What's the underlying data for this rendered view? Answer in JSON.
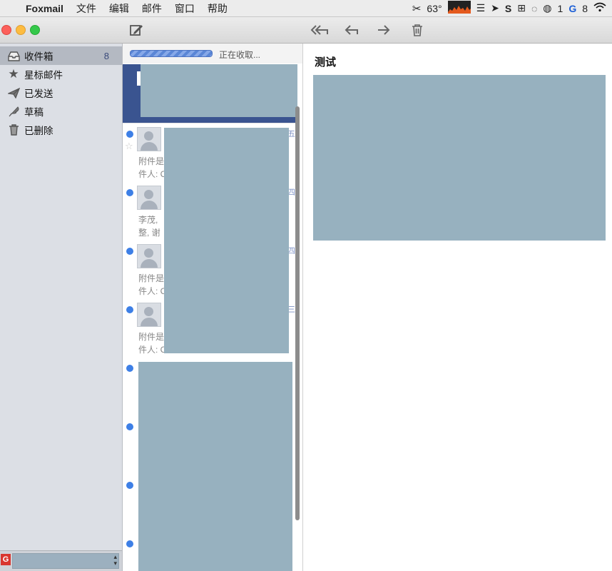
{
  "menubar": {
    "app_name": "Foxmail",
    "menus": [
      "文件",
      "编辑",
      "邮件",
      "窗口",
      "帮助"
    ],
    "status": {
      "temperature": "63°",
      "wechat_count": "1",
      "app_badge_count": "8"
    }
  },
  "sidebar": {
    "folders": [
      {
        "label": "收件箱",
        "count": "8",
        "icon": "inbox-icon"
      },
      {
        "label": "星标邮件",
        "icon": "star-icon"
      },
      {
        "label": "已发送",
        "icon": "paper-plane-icon"
      },
      {
        "label": "草稿",
        "icon": "feather-icon"
      },
      {
        "label": "已删除",
        "icon": "trash-icon"
      }
    ]
  },
  "message_list": {
    "progress_text": "正在收取...",
    "rows": [
      {
        "preview1": "",
        "preview2": "",
        "date": ""
      },
      {
        "preview1": "附件是",
        "preview2": "件人: C",
        "date": "五"
      },
      {
        "preview1": "李茂,",
        "preview2": "整, 谢",
        "date": "四"
      },
      {
        "preview1": "附件是",
        "preview2": "件人: C",
        "date": "四"
      },
      {
        "preview1": "附件是",
        "preview2": "件人: C",
        "date": "三"
      }
    ]
  },
  "reader": {
    "subject": "测试"
  },
  "colors": {
    "selection": "#3a5490",
    "unread_dot": "#3d7fe6",
    "redaction": "#97b1bf"
  }
}
